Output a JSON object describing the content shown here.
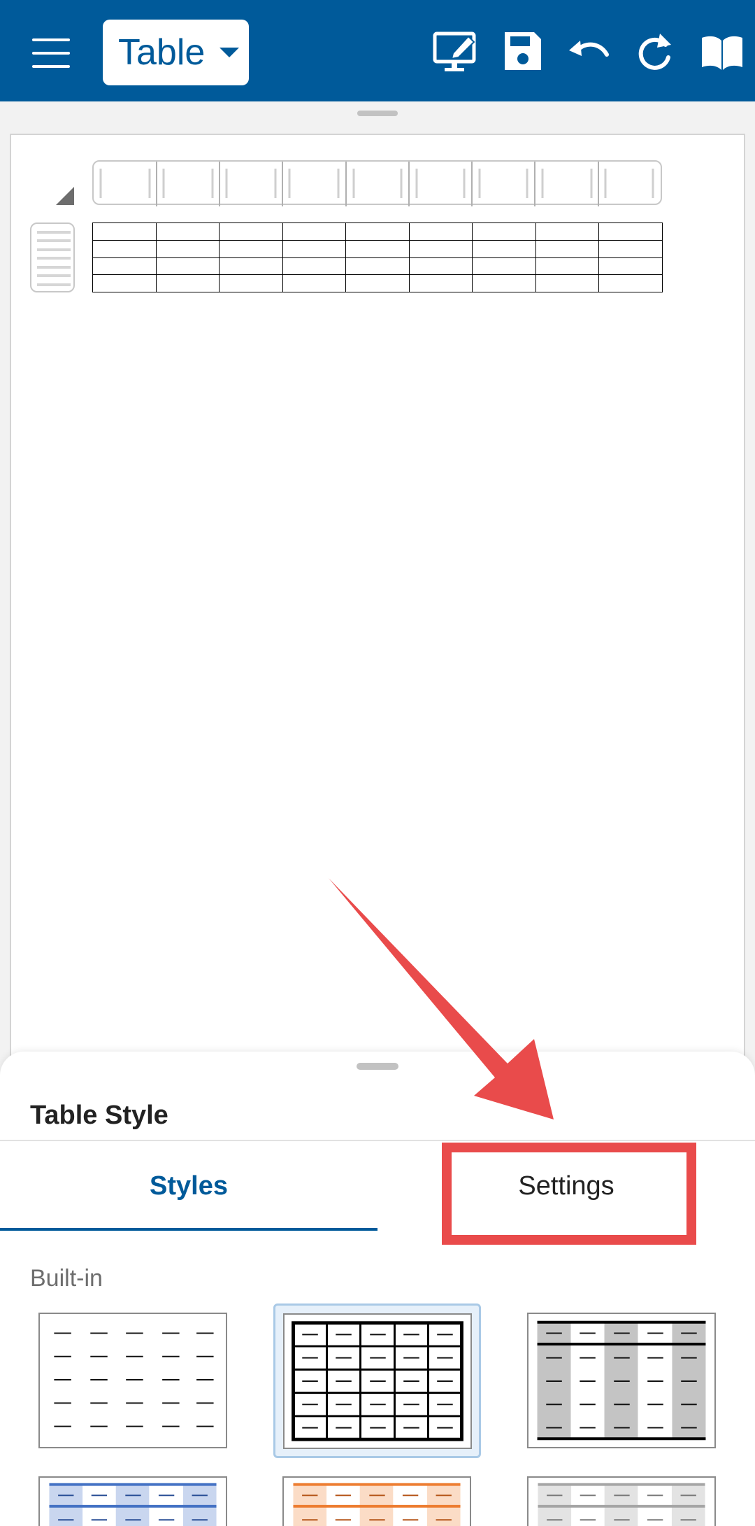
{
  "toolbar": {
    "mode_label": "Table",
    "colors": {
      "bar": "#005a9a",
      "icon": "#ffffff"
    },
    "icons": [
      "menu-icon",
      "edit-screen-icon",
      "save-icon",
      "undo-icon",
      "redo-icon",
      "read-mode-icon"
    ]
  },
  "document": {
    "table_rows": 4,
    "table_cols": 9
  },
  "sheet": {
    "title": "Table Style",
    "tabs": [
      {
        "label": "Styles",
        "active": true
      },
      {
        "label": "Settings",
        "active": false
      }
    ],
    "section_label": "Built-in",
    "styles": [
      {
        "name": "plain",
        "selected": false
      },
      {
        "name": "grid",
        "selected": true
      },
      {
        "name": "banded-gray",
        "selected": false
      },
      {
        "name": "banded-blue",
        "selected": false
      },
      {
        "name": "banded-orange",
        "selected": false
      },
      {
        "name": "banded-light-gray",
        "selected": false
      }
    ]
  },
  "annotation": {
    "color": "#e94b4b",
    "target": "Settings"
  }
}
